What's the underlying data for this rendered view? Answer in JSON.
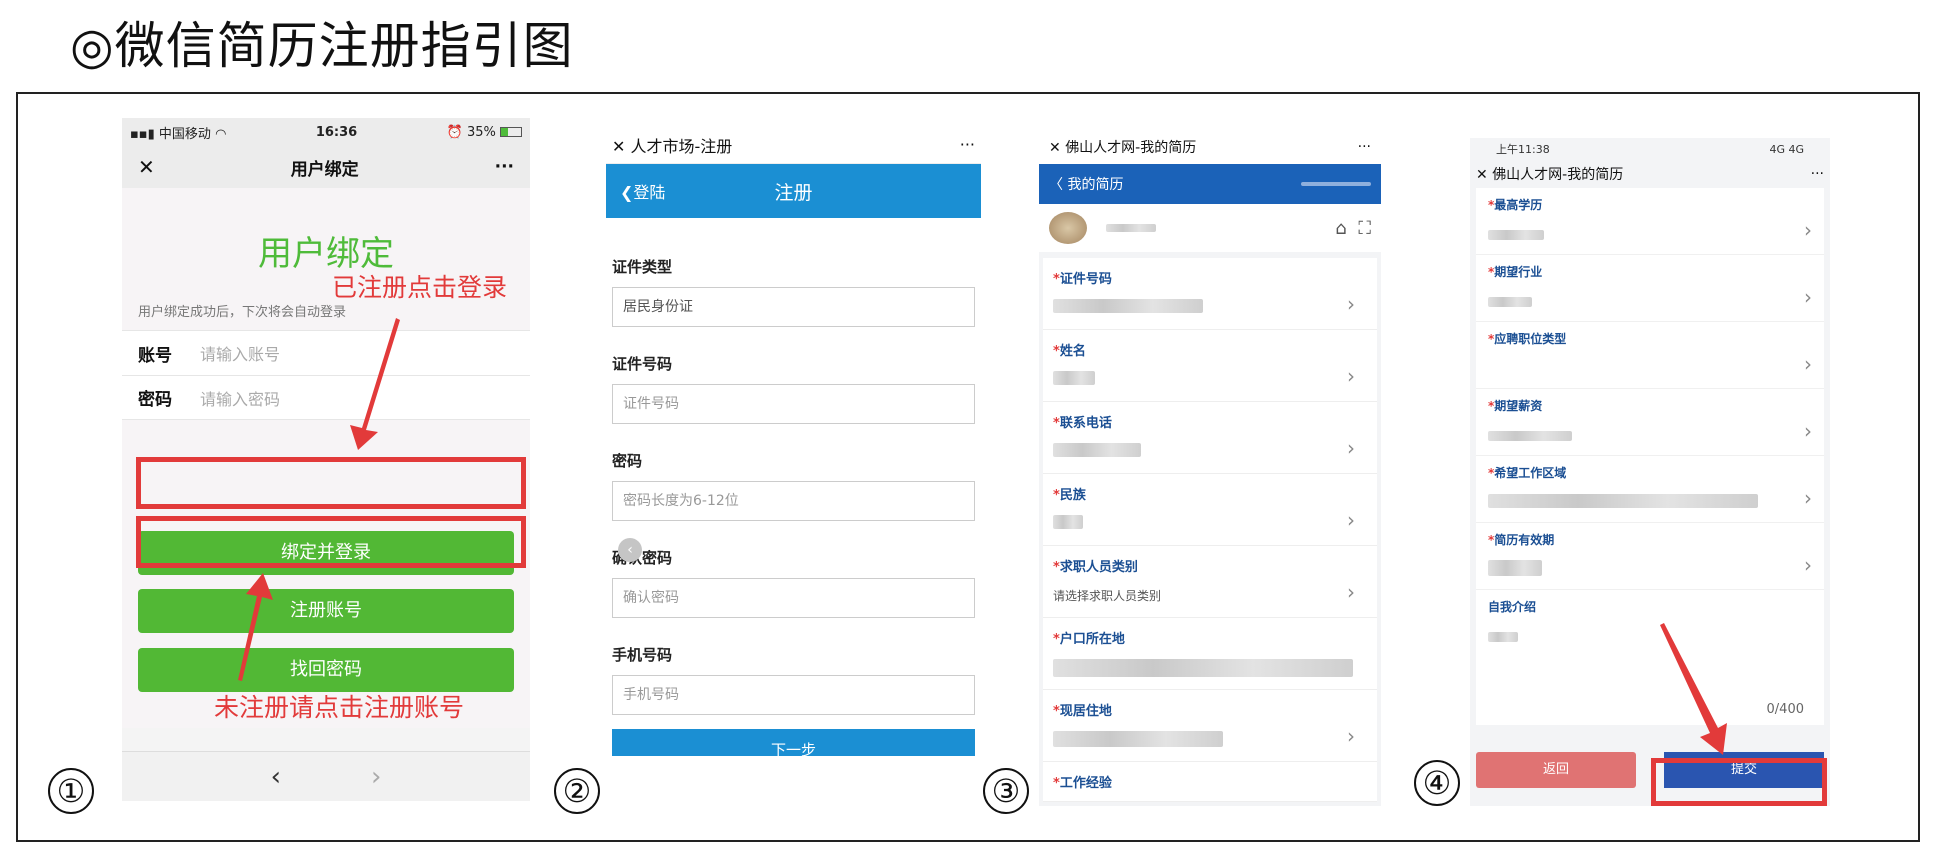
{
  "page_title": "◎微信简历注册指引图",
  "steps": [
    "①",
    "②",
    "③",
    "④"
  ],
  "screen1": {
    "status": {
      "carrier": "中国移动",
      "time": "16:36",
      "battery": "35%"
    },
    "nav": {
      "close": "✕",
      "title": "用户绑定",
      "more": "···"
    },
    "heading": "用户绑定",
    "hint": "用户绑定成功后，下次将会自动登录",
    "fields": [
      {
        "label": "账号",
        "placeholder": "请输入账号"
      },
      {
        "label": "密码",
        "placeholder": "请输入密码"
      }
    ],
    "buttons": {
      "bind_login": "绑定并登录",
      "register": "注册账号",
      "recover": "找回密码"
    },
    "bottom": {
      "back": "‹",
      "forward": "›"
    },
    "annotations": {
      "registered": "已注册点击登录",
      "unregistered": "未注册请点击注册账号"
    }
  },
  "screen2": {
    "top": {
      "close": "✕",
      "title": "人才市场-注册",
      "more": "···"
    },
    "bar": {
      "back": "❮登陆",
      "title": "注册"
    },
    "fields": [
      {
        "label": "证件类型",
        "value": "居民身份证"
      },
      {
        "label": "证件号码",
        "placeholder": "证件号码"
      },
      {
        "label": "密码",
        "placeholder": "密码长度为6-12位"
      },
      {
        "label": "确认密码",
        "placeholder": "确认密码"
      },
      {
        "label": "手机号码",
        "placeholder": "手机号码"
      }
    ],
    "float_icon": "‹",
    "next_button": "下一步"
  },
  "screen3": {
    "top": {
      "close": "✕",
      "title": "佛山人才网-我的简历",
      "more": "···"
    },
    "bar": {
      "back": "〈 我的简历"
    },
    "items": [
      {
        "label": "证件号码",
        "value": ""
      },
      {
        "label": "姓名",
        "value": ""
      },
      {
        "label": "联系电话",
        "value": ""
      },
      {
        "label": "民族",
        "value": ""
      },
      {
        "label": "求职人员类别",
        "value": "请选择求职人员类别"
      },
      {
        "label": "户口所在地",
        "value": ""
      },
      {
        "label": "现居住地",
        "value": ""
      },
      {
        "label": "工作经验",
        "value": ""
      }
    ],
    "required_mark": "*",
    "chevron": "›"
  },
  "screen4": {
    "status": {
      "time": "上午11:38",
      "network": "4G 4G"
    },
    "top": {
      "close": "✕",
      "title": "佛山人才网-我的简历",
      "more": "···"
    },
    "items": [
      {
        "label": "最高学历"
      },
      {
        "label": "期望行业"
      },
      {
        "label": "应聘职位类型"
      },
      {
        "label": "期望薪资"
      },
      {
        "label": "希望工作区域"
      },
      {
        "label": "简历有效期"
      }
    ],
    "intro_label": "自我介绍",
    "counter": "0/400",
    "buttons": {
      "back": "返回",
      "submit": "提交"
    },
    "required_mark": "*",
    "chevron": "›"
  },
  "colors": {
    "annotation_red": "#e23a3a",
    "wechat_green": "#52b835",
    "blue_bar": "#1b8fd3",
    "dark_blue": "#1b62b8"
  }
}
